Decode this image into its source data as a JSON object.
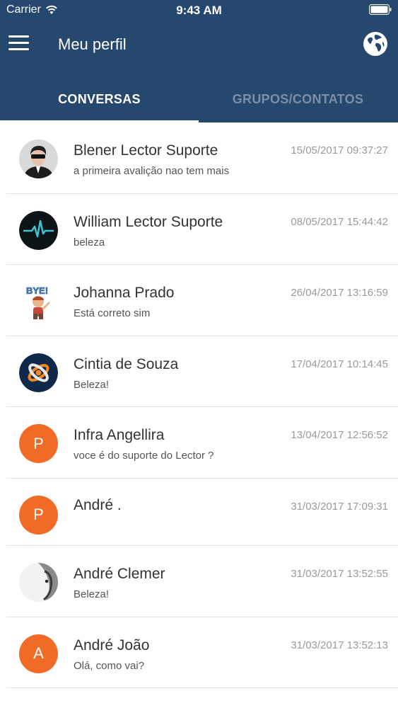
{
  "status_bar": {
    "carrier": "Carrier",
    "time": "9:43 AM"
  },
  "header": {
    "title": "Meu perfil"
  },
  "tabs": [
    {
      "label": "CONVERSAS",
      "active": true
    },
    {
      "label": "GRUPOS/CONTATOS",
      "active": false
    }
  ],
  "colors": {
    "header": "#26476e",
    "accent": "#f26b26",
    "inactive_tab": "#7b8fa8"
  },
  "conversations": [
    {
      "name": "Blener Lector Suporte",
      "message": "a primeira avalição nao tem mais",
      "timestamp": "15/05/2017 09:37:27",
      "avatar": "photo"
    },
    {
      "name": "William Lector Suporte",
      "message": "beleza",
      "timestamp": "08/05/2017 15:44:42",
      "avatar": "heartbeat"
    },
    {
      "name": "Johanna Prado",
      "message": "Está correto sim",
      "timestamp": "26/04/2017 13:16:59",
      "avatar": "bye-sticker"
    },
    {
      "name": "Cintia de Souza",
      "message": "Beleza!",
      "timestamp": "17/04/2017 10:14:45",
      "avatar": "logo"
    },
    {
      "name": "Infra Angellira",
      "message": "voce é do suporte do Lector ?",
      "timestamp": "13/04/2017 12:56:52",
      "avatar": "letter",
      "avatar_letter": "P"
    },
    {
      "name": "André .",
      "message": "",
      "timestamp": "31/03/2017 17:09:31",
      "avatar": "letter",
      "avatar_letter": "P"
    },
    {
      "name": "André Clemer",
      "message": "Beleza!",
      "timestamp": "31/03/2017 13:52:55",
      "avatar": "photo-bw"
    },
    {
      "name": "André João",
      "message": "Olá, como vai?",
      "timestamp": "31/03/2017 13:52:13",
      "avatar": "letter",
      "avatar_letter": "A"
    }
  ]
}
